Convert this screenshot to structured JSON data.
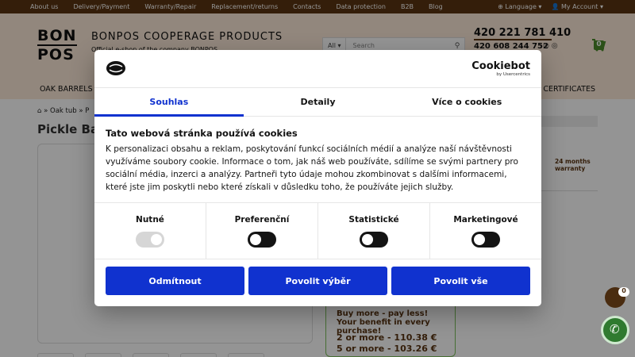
{
  "topbar": {
    "links": [
      "About us",
      "Delivery/Payment",
      "Warranty/Repair",
      "Replacement/returns",
      "Contacts",
      "Data protection",
      "B2B",
      "Blog"
    ],
    "language": "Language",
    "account": "My Account"
  },
  "header": {
    "logo_top": "BON",
    "logo_bottom": "POS",
    "brand": "BONPOS COOPERAGE PRODUCTS",
    "brand_sub": "Official e-shop of the company BONPOS",
    "search_scope": "All",
    "search_placeholder": "Search",
    "phone_main": "420 221 781 410",
    "phone_alt": "420 608 244 752",
    "cart_count": "0",
    "menu_left": "OAK BARRELS",
    "menu_right": "D CERTIFICATES"
  },
  "page": {
    "breadcrumb_oak_tub": "Oak tub",
    "breadcrumb_next": "P",
    "title": "Pickle Bar",
    "warranty": "24 months warranty",
    "buybox_title": "Buy more - pay less! Your benefit in every purchase!",
    "price_2": "2 or more - 110.38 €",
    "price_5": "5 or more - 103.26 €"
  },
  "floating": {
    "basket_count": "0"
  },
  "cookie_dialog": {
    "brand": "Cookiebot",
    "brand_sub": "by Usercentrics",
    "tabs": [
      "Souhlas",
      "Detaily",
      "Více o cookies"
    ],
    "active_tab": 0,
    "heading": "Tato webová stránka používá cookies",
    "text": "K personalizaci obsahu a reklam, poskytování funkcí sociálních médií a analýze naší návštěvnosti využíváme soubory cookie. Informace o tom, jak náš web používáte, sdílíme se svými partnery pro sociální média, inzerci a analýzy. Partneři tyto údaje mohou zkombinovat s dalšími informacemi, které jste jim poskytli nebo které získali v důsledku toho, že používáte jejich služby.",
    "categories": [
      {
        "label": "Nutné",
        "enabled": true
      },
      {
        "label": "Preferenční",
        "enabled": false
      },
      {
        "label": "Statistické",
        "enabled": false
      },
      {
        "label": "Marketingové",
        "enabled": false
      }
    ],
    "buttons": {
      "deny": "Odmítnout",
      "allow_selection": "Povolit výběr",
      "allow_all": "Povolit vše"
    },
    "accent_color": "#1032cf"
  }
}
